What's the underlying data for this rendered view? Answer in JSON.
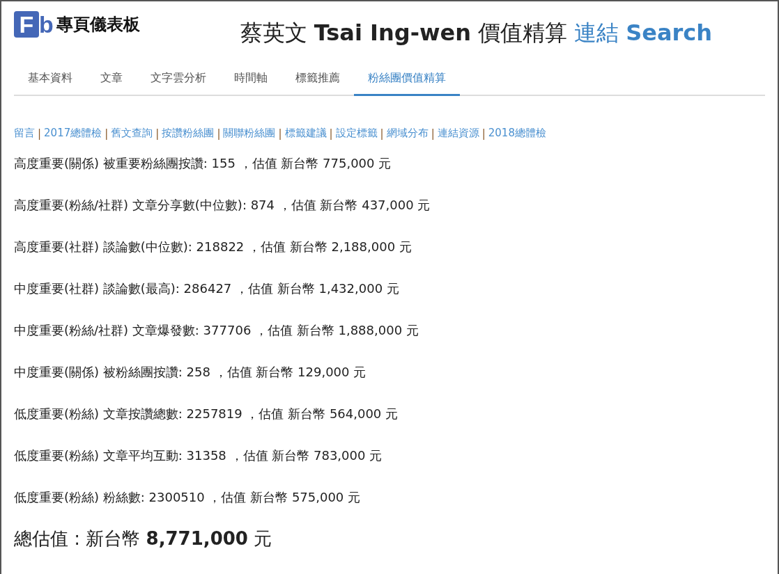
{
  "logo": {
    "mark": [
      "F",
      "b"
    ],
    "name": "專頁儀表板"
  },
  "header": {
    "title": "蔡英文 **Tsai Ing-wen** 價值精算",
    "links": [
      {
        "label": "連結",
        "kind": "plain"
      },
      {
        "label": "Search",
        "kind": "bold"
      }
    ]
  },
  "tabs": [
    {
      "label": "基本資料",
      "selected": false
    },
    {
      "label": "文章",
      "selected": false
    },
    {
      "label": "文字雲分析",
      "selected": false
    },
    {
      "label": "時間軸",
      "selected": false
    },
    {
      "label": "標籤推薦",
      "selected": false
    },
    {
      "label": "粉絲團價值精算",
      "selected": true
    }
  ],
  "sub_links": [
    {
      "label": "留言",
      "separator": "|"
    },
    {
      "label": "2017總體檢",
      "separator": "|"
    },
    {
      "label": "舊文查詢",
      "separator": "|"
    },
    {
      "label": "按讚粉絲團",
      "separator": "|"
    },
    {
      "label": "關聯粉絲團",
      "separator": "|"
    },
    {
      "label": "標籤建議",
      "separator": "|"
    },
    {
      "label": "設定標籤",
      "separator": "|"
    },
    {
      "label": "網域分布",
      "separator": "|"
    },
    {
      "label": "連結資源",
      "separator": "|"
    },
    {
      "label": "2018總體檢"
    }
  ],
  "valuations": [
    "高度重要(關係) 被重要粉絲團按讚: 155 ，估值 新台幣 775,000 元",
    "高度重要(粉絲/社群) 文章分享數(中位數): 874 ，估值 新台幣 437,000 元",
    "高度重要(社群) 談論數(中位數): 218822 ，估值 新台幣 2,188,000 元",
    "中度重要(社群) 談論數(最高): 286427 ，估值 新台幣 1,432,000 元",
    "中度重要(粉絲/社群) 文章爆發數: 377706 ，估值 新台幣 1,888,000 元",
    "中度重要(關係) 被粉絲團按讚: 258 ，估值 新台幣 129,000 元",
    "低度重要(粉絲) 文章按讚總數: 2257819 ，估值 新台幣 564,000 元",
    "低度重要(粉絲) 文章平均互動: 31358 ，估值 新台幣 783,000 元",
    "低度重要(粉絲) 粉絲數: 2300510 ，估值 新台幣 575,000 元"
  ],
  "total": "總估值 : 新台幣 **8,771,000** 元"
}
